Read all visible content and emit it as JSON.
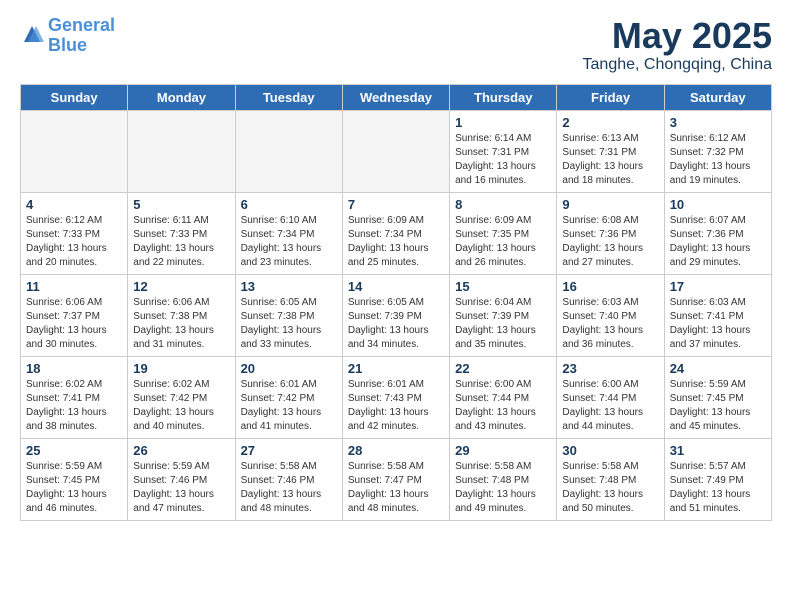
{
  "header": {
    "logo_line1": "General",
    "logo_line2": "Blue",
    "month": "May 2025",
    "location": "Tanghe, Chongqing, China"
  },
  "weekdays": [
    "Sunday",
    "Monday",
    "Tuesday",
    "Wednesday",
    "Thursday",
    "Friday",
    "Saturday"
  ],
  "weeks": [
    [
      {
        "day": "",
        "text": ""
      },
      {
        "day": "",
        "text": ""
      },
      {
        "day": "",
        "text": ""
      },
      {
        "day": "",
        "text": ""
      },
      {
        "day": "1",
        "text": "Sunrise: 6:14 AM\nSunset: 7:31 PM\nDaylight: 13 hours\nand 16 minutes."
      },
      {
        "day": "2",
        "text": "Sunrise: 6:13 AM\nSunset: 7:31 PM\nDaylight: 13 hours\nand 18 minutes."
      },
      {
        "day": "3",
        "text": "Sunrise: 6:12 AM\nSunset: 7:32 PM\nDaylight: 13 hours\nand 19 minutes."
      }
    ],
    [
      {
        "day": "4",
        "text": "Sunrise: 6:12 AM\nSunset: 7:33 PM\nDaylight: 13 hours\nand 20 minutes."
      },
      {
        "day": "5",
        "text": "Sunrise: 6:11 AM\nSunset: 7:33 PM\nDaylight: 13 hours\nand 22 minutes."
      },
      {
        "day": "6",
        "text": "Sunrise: 6:10 AM\nSunset: 7:34 PM\nDaylight: 13 hours\nand 23 minutes."
      },
      {
        "day": "7",
        "text": "Sunrise: 6:09 AM\nSunset: 7:34 PM\nDaylight: 13 hours\nand 25 minutes."
      },
      {
        "day": "8",
        "text": "Sunrise: 6:09 AM\nSunset: 7:35 PM\nDaylight: 13 hours\nand 26 minutes."
      },
      {
        "day": "9",
        "text": "Sunrise: 6:08 AM\nSunset: 7:36 PM\nDaylight: 13 hours\nand 27 minutes."
      },
      {
        "day": "10",
        "text": "Sunrise: 6:07 AM\nSunset: 7:36 PM\nDaylight: 13 hours\nand 29 minutes."
      }
    ],
    [
      {
        "day": "11",
        "text": "Sunrise: 6:06 AM\nSunset: 7:37 PM\nDaylight: 13 hours\nand 30 minutes."
      },
      {
        "day": "12",
        "text": "Sunrise: 6:06 AM\nSunset: 7:38 PM\nDaylight: 13 hours\nand 31 minutes."
      },
      {
        "day": "13",
        "text": "Sunrise: 6:05 AM\nSunset: 7:38 PM\nDaylight: 13 hours\nand 33 minutes."
      },
      {
        "day": "14",
        "text": "Sunrise: 6:05 AM\nSunset: 7:39 PM\nDaylight: 13 hours\nand 34 minutes."
      },
      {
        "day": "15",
        "text": "Sunrise: 6:04 AM\nSunset: 7:39 PM\nDaylight: 13 hours\nand 35 minutes."
      },
      {
        "day": "16",
        "text": "Sunrise: 6:03 AM\nSunset: 7:40 PM\nDaylight: 13 hours\nand 36 minutes."
      },
      {
        "day": "17",
        "text": "Sunrise: 6:03 AM\nSunset: 7:41 PM\nDaylight: 13 hours\nand 37 minutes."
      }
    ],
    [
      {
        "day": "18",
        "text": "Sunrise: 6:02 AM\nSunset: 7:41 PM\nDaylight: 13 hours\nand 38 minutes."
      },
      {
        "day": "19",
        "text": "Sunrise: 6:02 AM\nSunset: 7:42 PM\nDaylight: 13 hours\nand 40 minutes."
      },
      {
        "day": "20",
        "text": "Sunrise: 6:01 AM\nSunset: 7:42 PM\nDaylight: 13 hours\nand 41 minutes."
      },
      {
        "day": "21",
        "text": "Sunrise: 6:01 AM\nSunset: 7:43 PM\nDaylight: 13 hours\nand 42 minutes."
      },
      {
        "day": "22",
        "text": "Sunrise: 6:00 AM\nSunset: 7:44 PM\nDaylight: 13 hours\nand 43 minutes."
      },
      {
        "day": "23",
        "text": "Sunrise: 6:00 AM\nSunset: 7:44 PM\nDaylight: 13 hours\nand 44 minutes."
      },
      {
        "day": "24",
        "text": "Sunrise: 5:59 AM\nSunset: 7:45 PM\nDaylight: 13 hours\nand 45 minutes."
      }
    ],
    [
      {
        "day": "25",
        "text": "Sunrise: 5:59 AM\nSunset: 7:45 PM\nDaylight: 13 hours\nand 46 minutes."
      },
      {
        "day": "26",
        "text": "Sunrise: 5:59 AM\nSunset: 7:46 PM\nDaylight: 13 hours\nand 47 minutes."
      },
      {
        "day": "27",
        "text": "Sunrise: 5:58 AM\nSunset: 7:46 PM\nDaylight: 13 hours\nand 48 minutes."
      },
      {
        "day": "28",
        "text": "Sunrise: 5:58 AM\nSunset: 7:47 PM\nDaylight: 13 hours\nand 48 minutes."
      },
      {
        "day": "29",
        "text": "Sunrise: 5:58 AM\nSunset: 7:48 PM\nDaylight: 13 hours\nand 49 minutes."
      },
      {
        "day": "30",
        "text": "Sunrise: 5:58 AM\nSunset: 7:48 PM\nDaylight: 13 hours\nand 50 minutes."
      },
      {
        "day": "31",
        "text": "Sunrise: 5:57 AM\nSunset: 7:49 PM\nDaylight: 13 hours\nand 51 minutes."
      }
    ]
  ]
}
